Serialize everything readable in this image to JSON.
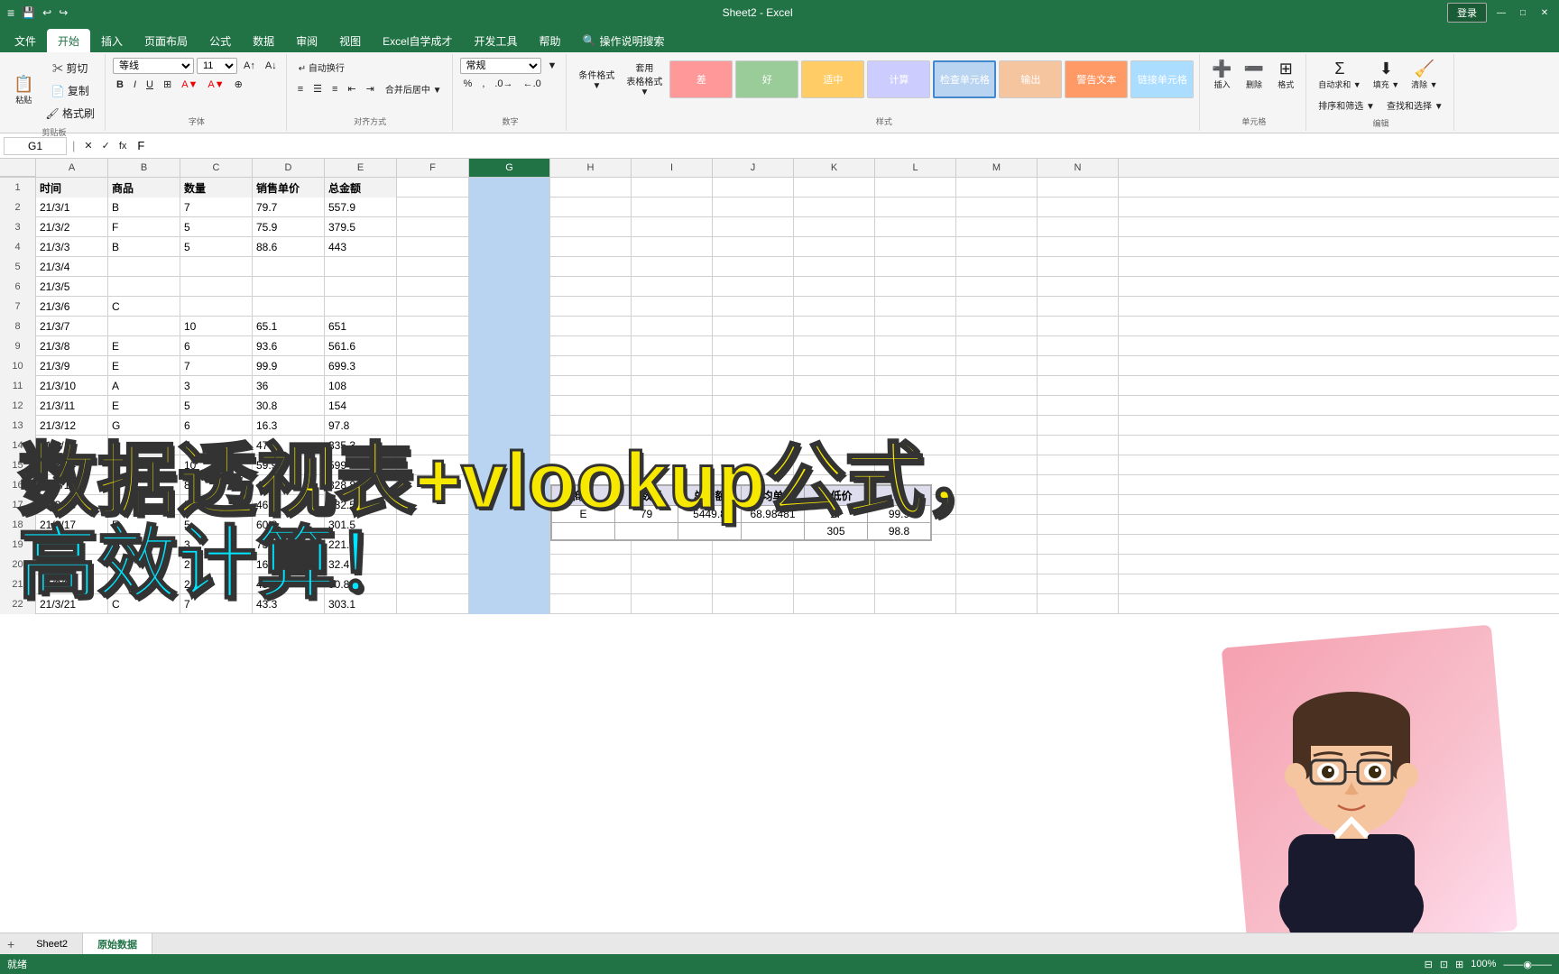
{
  "titlebar": {
    "title": "Sheet2 - Excel",
    "left_icon": "≡",
    "btn_min": "—",
    "btn_max": "□",
    "btn_close": "✕",
    "login_btn": "登录"
  },
  "ribbon": {
    "tabs": [
      "文件",
      "开始",
      "插入",
      "页面布局",
      "公式",
      "数据",
      "审阅",
      "视图",
      "Excel自学成才",
      "开发工具",
      "帮助",
      "操作说明搜索"
    ],
    "active_tab": "开始"
  },
  "formula_bar": {
    "cell_ref": "G1",
    "formula": "F"
  },
  "columns": {
    "headers": [
      "A",
      "B",
      "C",
      "D",
      "E",
      "F",
      "G",
      "H",
      "I",
      "J",
      "K",
      "L",
      "M",
      "N"
    ],
    "selected": "G"
  },
  "table_headers": {
    "col_a": "时间",
    "col_b": "商品",
    "col_c": "数量",
    "col_d": "销售单价",
    "col_e": "总金额"
  },
  "rows": [
    {
      "num": 1,
      "a": "时间",
      "b": "商品",
      "c": "数量",
      "d": "销售单价",
      "e": "总金额"
    },
    {
      "num": 2,
      "a": "21/3/1",
      "b": "B",
      "c": "7",
      "d": "79.7",
      "e": "557.9"
    },
    {
      "num": 3,
      "a": "21/3/2",
      "b": "F",
      "c": "5",
      "d": "75.9",
      "e": "379.5"
    },
    {
      "num": 4,
      "a": "21/3/3",
      "b": "B",
      "c": "5",
      "d": "88.6",
      "e": "443"
    },
    {
      "num": 5,
      "a": "21/3/4",
      "b": "",
      "c": "",
      "d": "",
      "e": ""
    },
    {
      "num": 6,
      "a": "21/3/5",
      "b": "",
      "c": "",
      "d": "",
      "e": ""
    },
    {
      "num": 7,
      "a": "21/3/6",
      "b": "C",
      "c": "",
      "d": "",
      "e": ""
    },
    {
      "num": 8,
      "a": "21/3/7",
      "b": "",
      "c": "10",
      "d": "65.1",
      "e": "651"
    },
    {
      "num": 9,
      "a": "21/3/8",
      "b": "E",
      "c": "6",
      "d": "93.6",
      "e": "561.6"
    },
    {
      "num": 10,
      "a": "21/3/9",
      "b": "E",
      "c": "7",
      "d": "99.9",
      "e": "699.3"
    },
    {
      "num": 11,
      "a": "21/3/10",
      "b": "A",
      "c": "3",
      "d": "36",
      "e": "108"
    },
    {
      "num": 12,
      "a": "21/3/11",
      "b": "E",
      "c": "5",
      "d": "30.8",
      "e": "154"
    },
    {
      "num": 13,
      "a": "21/3/12",
      "b": "G",
      "c": "6",
      "d": "16.3",
      "e": "97.8"
    },
    {
      "num": 14,
      "a": "21/3/13",
      "b": "B",
      "c": "7",
      "d": "47.9",
      "e": "335.3"
    },
    {
      "num": 15,
      "a": "21/3/14",
      "b": "D",
      "c": "10",
      "d": "59.9",
      "e": "599"
    },
    {
      "num": 16,
      "a": "21/3/15",
      "b": "B",
      "c": "8",
      "d": "41.1",
      "e": "328.8"
    },
    {
      "num": 17,
      "a": "21/3/16",
      "b": "F",
      "c": "5",
      "d": "46.5",
      "e": "232.5"
    },
    {
      "num": 18,
      "a": "21/3/17",
      "b": "E",
      "c": "5",
      "d": "60.3",
      "e": "301.5"
    },
    {
      "num": 19,
      "a": "21/3/18",
      "b": "D",
      "c": "3",
      "d": "73.9",
      "e": "221.7"
    },
    {
      "num": 20,
      "a": "21/3/19",
      "b": "C",
      "c": "2",
      "d": "16.2",
      "e": "32.4"
    },
    {
      "num": 21,
      "a": "21/3/20",
      "b": "D",
      "c": "2",
      "d": "45.4",
      "e": "90.8"
    },
    {
      "num": 22,
      "a": "21/3/21",
      "b": "C",
      "c": "7",
      "d": "43.3",
      "e": "303.1"
    }
  ],
  "overlay_table": {
    "headers": [
      "商品",
      "销数量",
      "总金额",
      "平均单价",
      "最低价"
    ],
    "rows": [
      {
        "product": "E",
        "qty": "79",
        "total": "5449.8",
        "avg": "68.98481",
        "min_price": "17",
        "col6": "99.9"
      },
      {
        "product": "",
        "qty": "",
        "total": "",
        "avg": "",
        "min_price": "305",
        "col6": "98.8"
      }
    ]
  },
  "overlay_text": {
    "line1": "数据透视表+vlookup公式，",
    "line2": "高效计算！"
  },
  "style_cells": {
    "bad": "差",
    "good": "好",
    "neutral": "适中",
    "calc": "计算",
    "check": "检查单元格",
    "output": "输出",
    "warn": "警告文本",
    "link": "链接单元格"
  },
  "statusbar": {
    "sheet1": "Sheet2",
    "sheet2": "原始数据",
    "ready": "就绪",
    "zoom": "100%"
  },
  "font_options": {
    "font_name": "等线",
    "font_size": "11",
    "format_type": "常规"
  }
}
